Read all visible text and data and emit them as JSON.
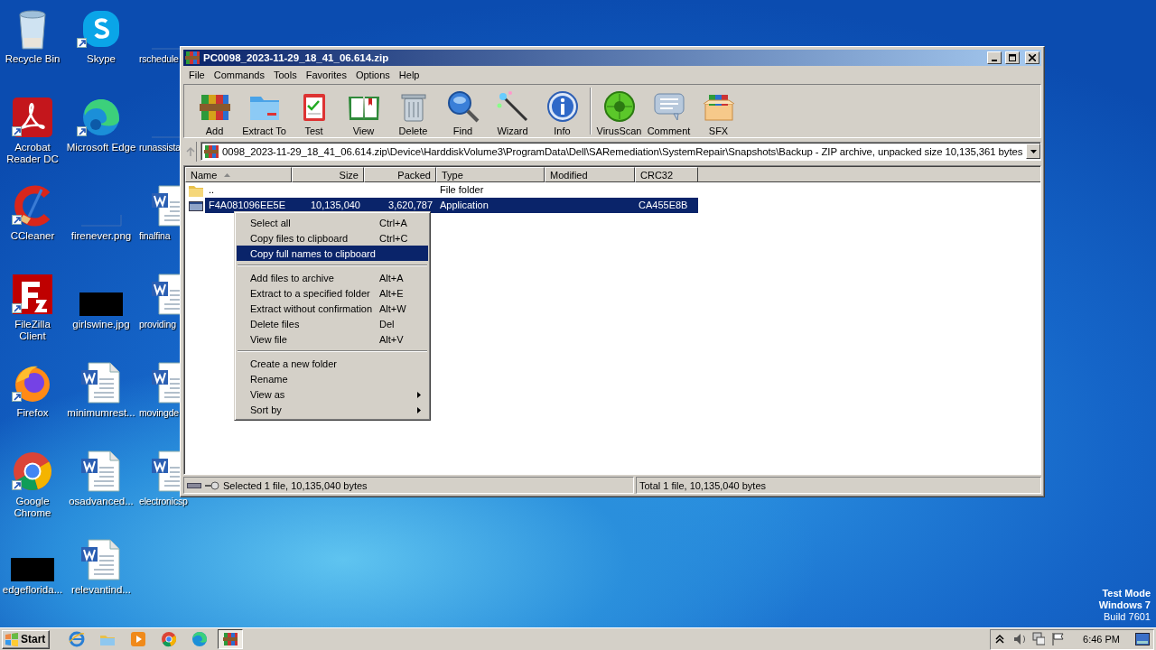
{
  "desktop": {
    "icons": [
      {
        "label": "Recycle Bin",
        "kind": "recycle",
        "shortcut": false
      },
      {
        "label": "Acrobat Reader DC",
        "kind": "acrobat",
        "shortcut": true
      },
      {
        "label": "CCleaner",
        "kind": "ccleaner",
        "shortcut": true
      },
      {
        "label": "FileZilla Client",
        "kind": "filezilla",
        "shortcut": true
      },
      {
        "label": "Firefox",
        "kind": "firefox",
        "shortcut": true
      },
      {
        "label": "Google Chrome",
        "kind": "chrome",
        "shortcut": true
      },
      {
        "label": "edgeflorida...",
        "kind": "image",
        "shortcut": false
      },
      {
        "label": "Skype",
        "kind": "skype",
        "shortcut": true
      },
      {
        "label": "Microsoft Edge",
        "kind": "edge",
        "shortcut": true
      },
      {
        "label": "firenever.png",
        "kind": "blank",
        "shortcut": false
      },
      {
        "label": "girlswine.jpg",
        "kind": "image",
        "shortcut": false
      },
      {
        "label": "minimumrest...",
        "kind": "word",
        "shortcut": false
      },
      {
        "label": "osadvanced...",
        "kind": "word",
        "shortcut": false
      },
      {
        "label": "relevantind...",
        "kind": "word",
        "shortcut": false
      },
      {
        "label": "rschedule",
        "kind": "blank",
        "shortcut": false
      },
      {
        "label": "runassista",
        "kind": "blank",
        "shortcut": false
      },
      {
        "label": "finalfina",
        "kind": "word",
        "shortcut": false
      },
      {
        "label": "providing",
        "kind": "word",
        "shortcut": false
      },
      {
        "label": "movingde",
        "kind": "word",
        "shortcut": false
      },
      {
        "label": "electronicsp",
        "kind": "word",
        "shortcut": false
      }
    ],
    "os_info": [
      "Test Mode",
      "Windows 7",
      "Build 7601"
    ]
  },
  "window": {
    "title": "PC0098_2023-11-29_18_41_06.614.zip",
    "menu": [
      "File",
      "Commands",
      "Tools",
      "Favorites",
      "Options",
      "Help"
    ],
    "toolbar": [
      [
        {
          "label": "Add",
          "kind": "add"
        },
        {
          "label": "Extract To",
          "kind": "extract"
        },
        {
          "label": "Test",
          "kind": "test"
        },
        {
          "label": "View",
          "kind": "view"
        },
        {
          "label": "Delete",
          "kind": "delete"
        },
        {
          "label": "Find",
          "kind": "find"
        },
        {
          "label": "Wizard",
          "kind": "wizard"
        },
        {
          "label": "Info",
          "kind": "info"
        }
      ],
      [
        {
          "label": "VirusScan",
          "kind": "virus"
        },
        {
          "label": "Comment",
          "kind": "comment"
        },
        {
          "label": "SFX",
          "kind": "sfx"
        }
      ]
    ],
    "address": "0098_2023-11-29_18_41_06.614.zip\\Device\\HarddiskVolume3\\ProgramData\\Dell\\SARemediation\\SystemRepair\\Snapshots\\Backup - ZIP archive, unpacked size 10,135,361 bytes",
    "table": {
      "columns": [
        {
          "label": "Name",
          "kind": "text",
          "sorted": true
        },
        {
          "label": "Size",
          "kind": "number",
          "sorted": false
        },
        {
          "label": "Packed",
          "kind": "number",
          "sorted": false
        },
        {
          "label": "Type",
          "kind": "text",
          "sorted": false
        },
        {
          "label": "Modified",
          "kind": "text",
          "sorted": false
        },
        {
          "label": "CRC32",
          "kind": "text",
          "sorted": false
        }
      ],
      "rows": [
        {
          "kind": "folder",
          "selected": false,
          "cells": {
            "name": "..",
            "type": "File folder"
          }
        },
        {
          "kind": "file",
          "selected": true,
          "cells": {
            "name": "F4A081096EE5E",
            "size": "10,135,040",
            "packed": "3,620,787",
            "type": "Application",
            "crc32": "CA455E8B"
          }
        }
      ]
    },
    "context_menu": [
      {
        "kind": "item",
        "label": "Select all",
        "shortcut": "Ctrl+A",
        "selected": false,
        "submenu": false
      },
      {
        "kind": "item",
        "label": "Copy files to clipboard",
        "shortcut": "Ctrl+C",
        "selected": false,
        "submenu": false
      },
      {
        "kind": "item",
        "label": "Copy full names to clipboard",
        "selected": true,
        "submenu": false
      },
      {
        "kind": "separator"
      },
      {
        "kind": "item",
        "label": "Add files to archive",
        "shortcut": "Alt+A",
        "selected": false,
        "submenu": false
      },
      {
        "kind": "item",
        "label": "Extract to a specified folder",
        "shortcut": "Alt+E",
        "selected": false,
        "submenu": false
      },
      {
        "kind": "item",
        "label": "Extract without confirmation",
        "shortcut": "Alt+W",
        "selected": false,
        "submenu": false
      },
      {
        "kind": "item",
        "label": "Delete files",
        "shortcut": "Del",
        "selected": false,
        "submenu": false
      },
      {
        "kind": "item",
        "label": "View file",
        "shortcut": "Alt+V",
        "selected": false,
        "submenu": false
      },
      {
        "kind": "separator"
      },
      {
        "kind": "item",
        "label": "Create a new folder",
        "selected": false,
        "submenu": false
      },
      {
        "kind": "item",
        "label": "Rename",
        "selected": false,
        "submenu": false
      },
      {
        "kind": "item",
        "label": "View as",
        "selected": false,
        "submenu": true
      },
      {
        "kind": "item",
        "label": "Sort by",
        "selected": false,
        "submenu": true
      }
    ],
    "status_bar": [
      "Selected 1 file, 10,135,040 bytes",
      "Total 1 file, 10,135,040 bytes"
    ]
  },
  "taskbar": {
    "start": "Start",
    "apps": [
      {
        "kind": "ie",
        "active": false
      },
      {
        "kind": "explorer",
        "active": false
      },
      {
        "kind": "media",
        "active": false
      },
      {
        "kind": "chrome",
        "active": false
      },
      {
        "kind": "edge",
        "active": false
      },
      {
        "kind": "winrar",
        "active": true
      }
    ],
    "clock": "6:46 PM"
  }
}
